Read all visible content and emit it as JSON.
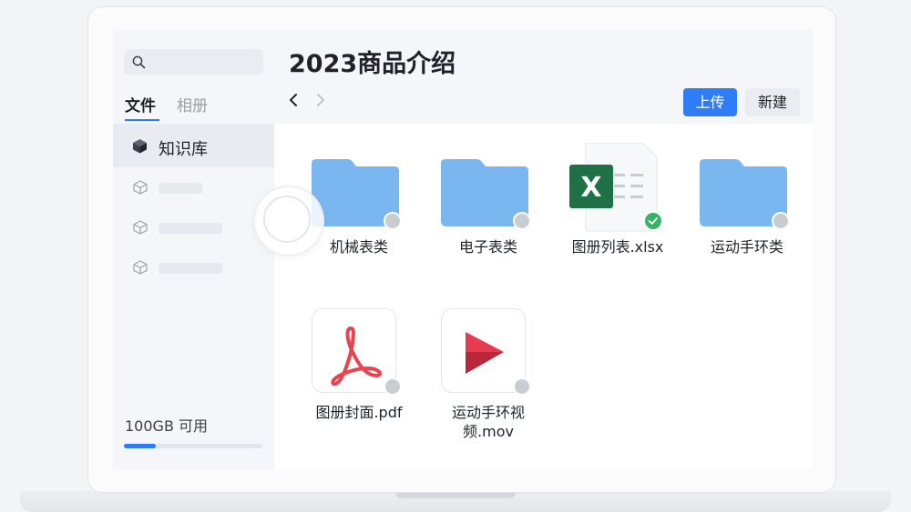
{
  "sidebar": {
    "search_placeholder": "",
    "tabs": [
      {
        "label": "文件",
        "active": true
      },
      {
        "label": "相册",
        "active": false
      }
    ],
    "items": [
      {
        "label": "知识库",
        "icon": "cube-icon",
        "active": true
      }
    ],
    "storage": {
      "label": "100GB 可用",
      "used_fraction": 0.23
    }
  },
  "header": {
    "title": "2023商品介绍",
    "upload_label": "上传",
    "new_label": "新建"
  },
  "files": [
    {
      "name": "机械表类",
      "type": "folder",
      "status": "cloud"
    },
    {
      "name": "电子表类",
      "type": "folder",
      "status": "cloud"
    },
    {
      "name": "图册列表.xlsx",
      "type": "excel",
      "status": "synced"
    },
    {
      "name": "运动手环类",
      "type": "folder",
      "status": "cloud"
    },
    {
      "name": "图册封面.pdf",
      "type": "pdf",
      "status": "cloud"
    },
    {
      "name": "运动手环视频.mov",
      "type": "video",
      "status": "cloud"
    }
  ],
  "colors": {
    "accent": "#2e7cf6",
    "folder": "#7ab7f0",
    "excel": "#1e7145",
    "pdf": "#e8434f",
    "video": "#e53c50",
    "synced": "#36b366"
  }
}
